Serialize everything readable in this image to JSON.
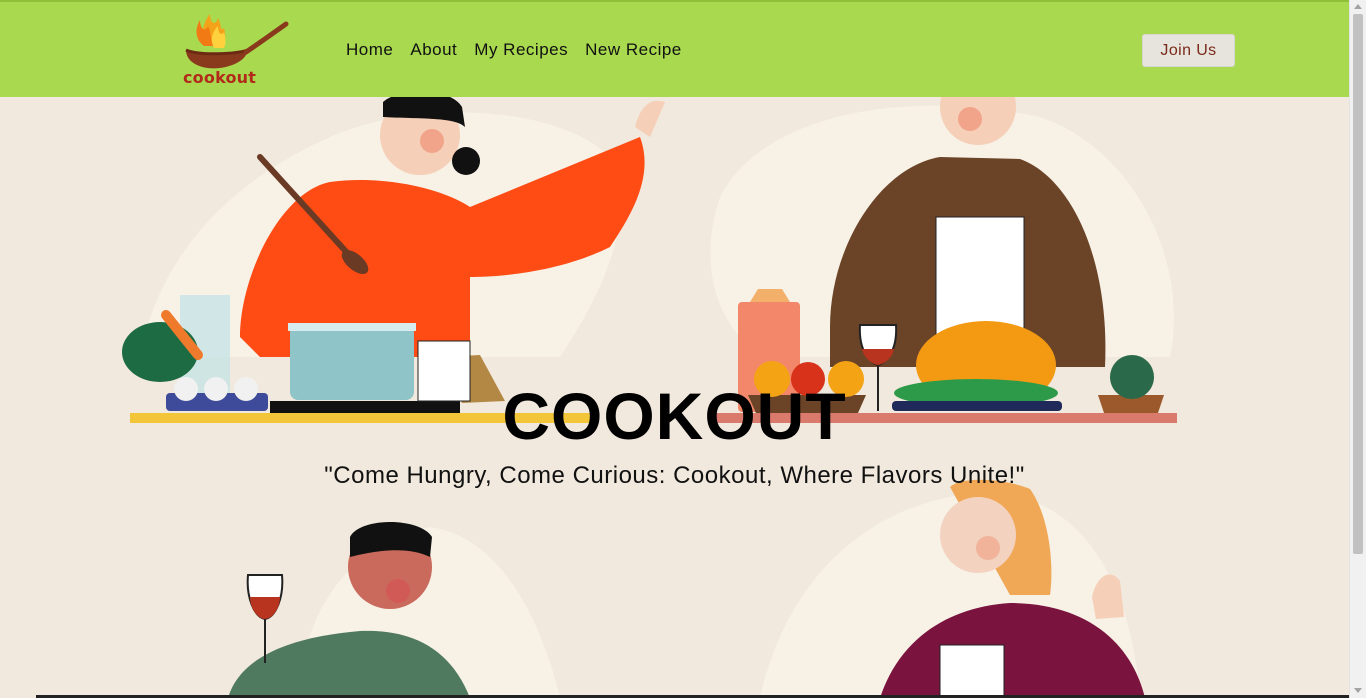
{
  "header": {
    "logo_text": "cookout",
    "nav": [
      "Home",
      "About",
      "My Recipes",
      "New Recipe"
    ],
    "join_label": "Join Us"
  },
  "hero": {
    "title": "COOKOUT",
    "tagline": "\"Come Hungry, Come Curious: Cookout, Where Flavors Unite!\""
  },
  "colors": {
    "navbar": "#a8d94f",
    "background": "#f1e9dd",
    "accent_text": "#b22a1a"
  }
}
